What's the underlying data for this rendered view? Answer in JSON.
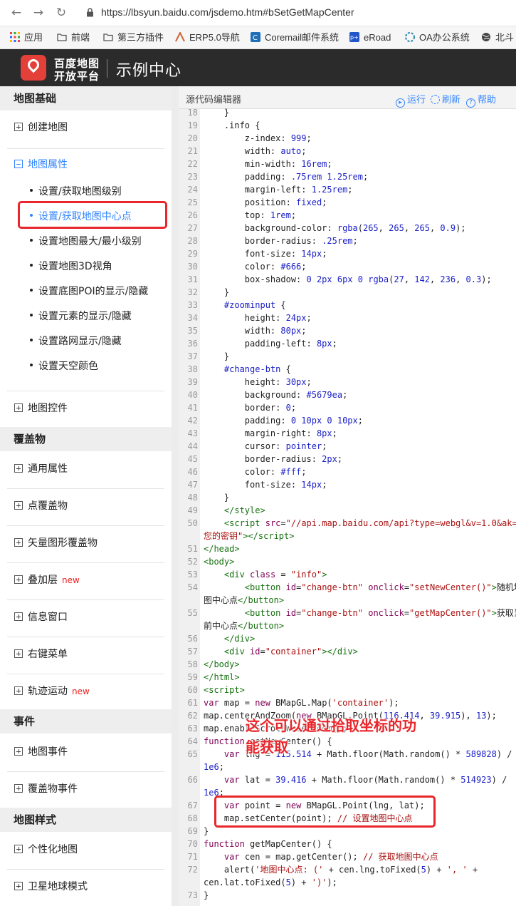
{
  "browser": {
    "url": "https://lbsyun.baidu.com/jsdemo.htm#bSetGetMapCenter",
    "bookmarks": [
      "应用",
      "前端",
      "第三方插件",
      "ERP5.0导航",
      "Coremail邮件系统",
      "eRoad",
      "OA办公系统",
      "北斗"
    ]
  },
  "header": {
    "logo_line1": "百度地图",
    "logo_line2": "开放平台",
    "title": "示例中心"
  },
  "sidebar": {
    "sections": [
      "地图基础",
      "覆盖物",
      "事件",
      "地图样式"
    ],
    "items": {
      "create_map": "创建地图",
      "map_props": "地图属性",
      "map_controls": "地图控件",
      "general_props": "通用属性",
      "point_overlay": "点覆盖物",
      "vector_overlay": "矢量图形覆盖物",
      "layer": "叠加层",
      "info_window": "信息窗口",
      "context_menu": "右键菜单",
      "track_motion": "轨迹运动",
      "map_events": "地图事件",
      "overlay_events": "覆盖物事件",
      "custom_map": "个性化地图",
      "satellite": "卫星地球模式"
    },
    "new_tag": "new",
    "sub_items": [
      "设置/获取地图级别",
      "设置/获取地图中心点",
      "设置地图最大/最小级别",
      "设置地图3D视角",
      "设置底图POI的显示/隐藏",
      "设置元素的显示/隐藏",
      "设置路网显示/隐藏",
      "设置天空颜色"
    ]
  },
  "editor": {
    "title": "源代码编辑器",
    "run": "运行",
    "refresh": "刷新",
    "help": "帮助"
  },
  "annotation": {
    "line1": "这个可以通过拾取坐标的功",
    "line2": "能获取"
  },
  "code_lines": [
    {
      "n": "18",
      "html": "    }"
    },
    {
      "n": "19",
      "html": "    .info {"
    },
    {
      "n": "20",
      "html": "        z-index: <span class=\"n\">999</span>;"
    },
    {
      "n": "21",
      "html": "        width: <span class=\"b\">auto</span>;"
    },
    {
      "n": "22",
      "html": "        min-width: <span class=\"n\">16rem</span>;"
    },
    {
      "n": "23",
      "html": "        padding: <span class=\"n\">.75rem 1.25rem</span>;"
    },
    {
      "n": "24",
      "html": "        margin-left: <span class=\"n\">1.25rem</span>;"
    },
    {
      "n": "25",
      "html": "        position: <span class=\"b\">fixed</span>;"
    },
    {
      "n": "26",
      "html": "        top: <span class=\"n\">1rem</span>;"
    },
    {
      "n": "27",
      "html": "        background-color: <span class=\"b\">rgba</span>(<span class=\"n\">265</span>, <span class=\"n\">265</span>, <span class=\"n\">265</span>, <span class=\"n\">0.9</span>);"
    },
    {
      "n": "28",
      "html": "        border-radius: <span class=\"n\">.25rem</span>;"
    },
    {
      "n": "29",
      "html": "        font-size: <span class=\"n\">14px</span>;"
    },
    {
      "n": "30",
      "html": "        color: <span class=\"b\">#666</span>;"
    },
    {
      "n": "31",
      "html": "        box-shadow: <span class=\"n\">0 2px 6px 0</span> <span class=\"b\">rgba</span>(<span class=\"n\">27</span>, <span class=\"n\">142</span>, <span class=\"n\">236</span>, <span class=\"n\">0.3</span>);"
    },
    {
      "n": "32",
      "html": "    }"
    },
    {
      "n": "33",
      "html": "    <span class=\"b\">#zoominput</span> {"
    },
    {
      "n": "34",
      "html": "        height: <span class=\"n\">24px</span>;"
    },
    {
      "n": "35",
      "html": "        width: <span class=\"n\">80px</span>;"
    },
    {
      "n": "36",
      "html": "        padding-left: <span class=\"n\">8px</span>;"
    },
    {
      "n": "37",
      "html": "    }"
    },
    {
      "n": "38",
      "html": "    <span class=\"b\">#change-btn</span> {"
    },
    {
      "n": "39",
      "html": "        height: <span class=\"n\">30px</span>;"
    },
    {
      "n": "40",
      "html": "        background: <span class=\"b\">#5679ea</span>;"
    },
    {
      "n": "41",
      "html": "        border: <span class=\"n\">0</span>;"
    },
    {
      "n": "42",
      "html": "        padding: <span class=\"n\">0 10px 0 10px</span>;"
    },
    {
      "n": "43",
      "html": "        margin-right: <span class=\"n\">8px</span>;"
    },
    {
      "n": "44",
      "html": "        cursor: <span class=\"b\">pointer</span>;"
    },
    {
      "n": "45",
      "html": "        border-radius: <span class=\"n\">2px</span>;"
    },
    {
      "n": "46",
      "html": "        color: <span class=\"b\">#fff</span>;"
    },
    {
      "n": "47",
      "html": "        font-size: <span class=\"n\">14px</span>;"
    },
    {
      "n": "48",
      "html": "    }"
    },
    {
      "n": "49",
      "html": "    <span class=\"t\">&lt;/style&gt;</span>"
    },
    {
      "n": "50",
      "html": "    <span class=\"t\">&lt;script</span> <span class=\"k\">src</span>=<span class=\"s\">\"//api.map.baidu.com/api?type=webgl&amp;v=1.0&amp;ak=</span>"
    },
    {
      "n": "",
      "html": "<span class=\"s\">您的密钥\"</span><span class=\"t\">&gt;&lt;/script&gt;</span>"
    },
    {
      "n": "51",
      "html": "<span class=\"t\">&lt;/head&gt;</span>"
    },
    {
      "n": "52",
      "html": "<span class=\"t\">&lt;body&gt;</span>"
    },
    {
      "n": "53",
      "html": "    <span class=\"t\">&lt;div</span> <span class=\"k\">class</span> = <span class=\"s\">\"info\"</span><span class=\"t\">&gt;</span>"
    },
    {
      "n": "54",
      "html": "        <span class=\"t\">&lt;button</span> <span class=\"k\">id</span>=<span class=\"s\">\"change-btn\"</span> <span class=\"k\">onclick</span>=<span class=\"s\">\"setNewCenter()\"</span><span class=\"t\">&gt;</span>随机地"
    },
    {
      "n": "",
      "html": "图中心点<span class=\"t\">&lt;/button&gt;</span>"
    },
    {
      "n": "55",
      "html": "        <span class=\"t\">&lt;button</span> <span class=\"k\">id</span>=<span class=\"s\">\"change-btn\"</span> <span class=\"k\">onclick</span>=<span class=\"s\">\"getMapCenter()\"</span><span class=\"t\">&gt;</span>获取当"
    },
    {
      "n": "",
      "html": "前中心点<span class=\"t\">&lt;/button&gt;</span>"
    },
    {
      "n": "56",
      "html": "    <span class=\"t\">&lt;/div&gt;</span>"
    },
    {
      "n": "57",
      "html": "    <span class=\"t\">&lt;div</span> <span class=\"k\">id</span>=<span class=\"s\">\"container\"</span><span class=\"t\">&gt;&lt;/div&gt;</span>"
    },
    {
      "n": "58",
      "html": "<span class=\"t\">&lt;/body&gt;</span>"
    },
    {
      "n": "59",
      "html": "<span class=\"t\">&lt;/html&gt;</span>"
    },
    {
      "n": "60",
      "html": "<span class=\"t\">&lt;script&gt;</span>"
    },
    {
      "n": "61",
      "html": "<span class=\"k\">var</span> map = <span class=\"k\">new</span> BMapGL.Map(<span class=\"s\">'container'</span>);"
    },
    {
      "n": "62",
      "html": "map.centerAndZoom(<span class=\"k\">new</span> BMapGL.Point(<span class=\"n\">116.414</span>, <span class=\"n\">39.915</span>), <span class=\"n\">13</span>);"
    },
    {
      "n": "63",
      "html": "map.enableScrollWheelZoom();"
    },
    {
      "n": "64",
      "html": "<span class=\"k\">function</span> setNewCenter() {"
    },
    {
      "n": "65",
      "html": "    <span class=\"k\">var</span> lng = <span class=\"n\">115.514</span> + Math.floor(Math.random() * <span class=\"n\">589828</span>) /"
    },
    {
      "n": "",
      "html": "<span class=\"n\">1e6</span>;"
    },
    {
      "n": "66",
      "html": "    <span class=\"k\">var</span> lat = <span class=\"n\">39.416</span> + Math.floor(Math.random() * <span class=\"n\">514923</span>) /"
    },
    {
      "n": "",
      "html": "<span class=\"n\">1e6</span>;"
    },
    {
      "n": "67",
      "html": "    <span class=\"k\">var</span> point = <span class=\"k\">new</span> BMapGL.Point(lng, lat);"
    },
    {
      "n": "68",
      "html": "    map.setCenter(point); <span class=\"s\">// 设置地图中心点</span>"
    },
    {
      "n": "69",
      "html": "}"
    },
    {
      "n": "70",
      "html": "<span class=\"k\">function</span> getMapCenter() {"
    },
    {
      "n": "71",
      "html": "    <span class=\"k\">var</span> cen = map.getCenter(); <span class=\"s\">// 获取地图中心点</span>"
    },
    {
      "n": "72",
      "html": "    alert(<span class=\"s\">'地图中心点: ('</span> + cen.lng.toFixed(<span class=\"n\">5</span>) + <span class=\"s\">', '</span> +"
    },
    {
      "n": "",
      "html": "cen.lat.toFixed(<span class=\"n\">5</span>) + <span class=\"s\">')'</span>);"
    },
    {
      "n": "73",
      "html": "}"
    }
  ]
}
